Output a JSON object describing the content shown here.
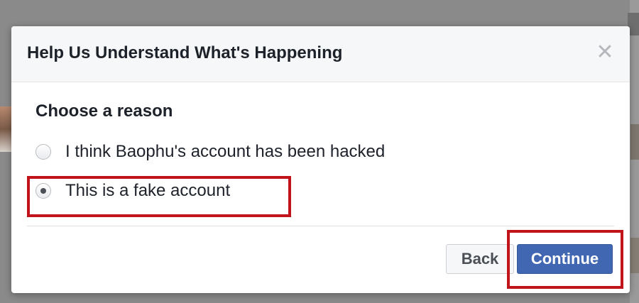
{
  "dialog": {
    "title": "Help Us Understand What's Happening",
    "close_icon": "close-icon",
    "section_title": "Choose a reason",
    "options": [
      {
        "label": "I think Baophu's account has been hacked",
        "checked": false
      },
      {
        "label": "This is a fake account",
        "checked": true
      }
    ],
    "buttons": {
      "back_label": "Back",
      "continue_label": "Continue"
    }
  },
  "colors": {
    "primary_button": "#4267b2",
    "highlight": "#c0141a",
    "header_bg": "#f6f7f9"
  }
}
